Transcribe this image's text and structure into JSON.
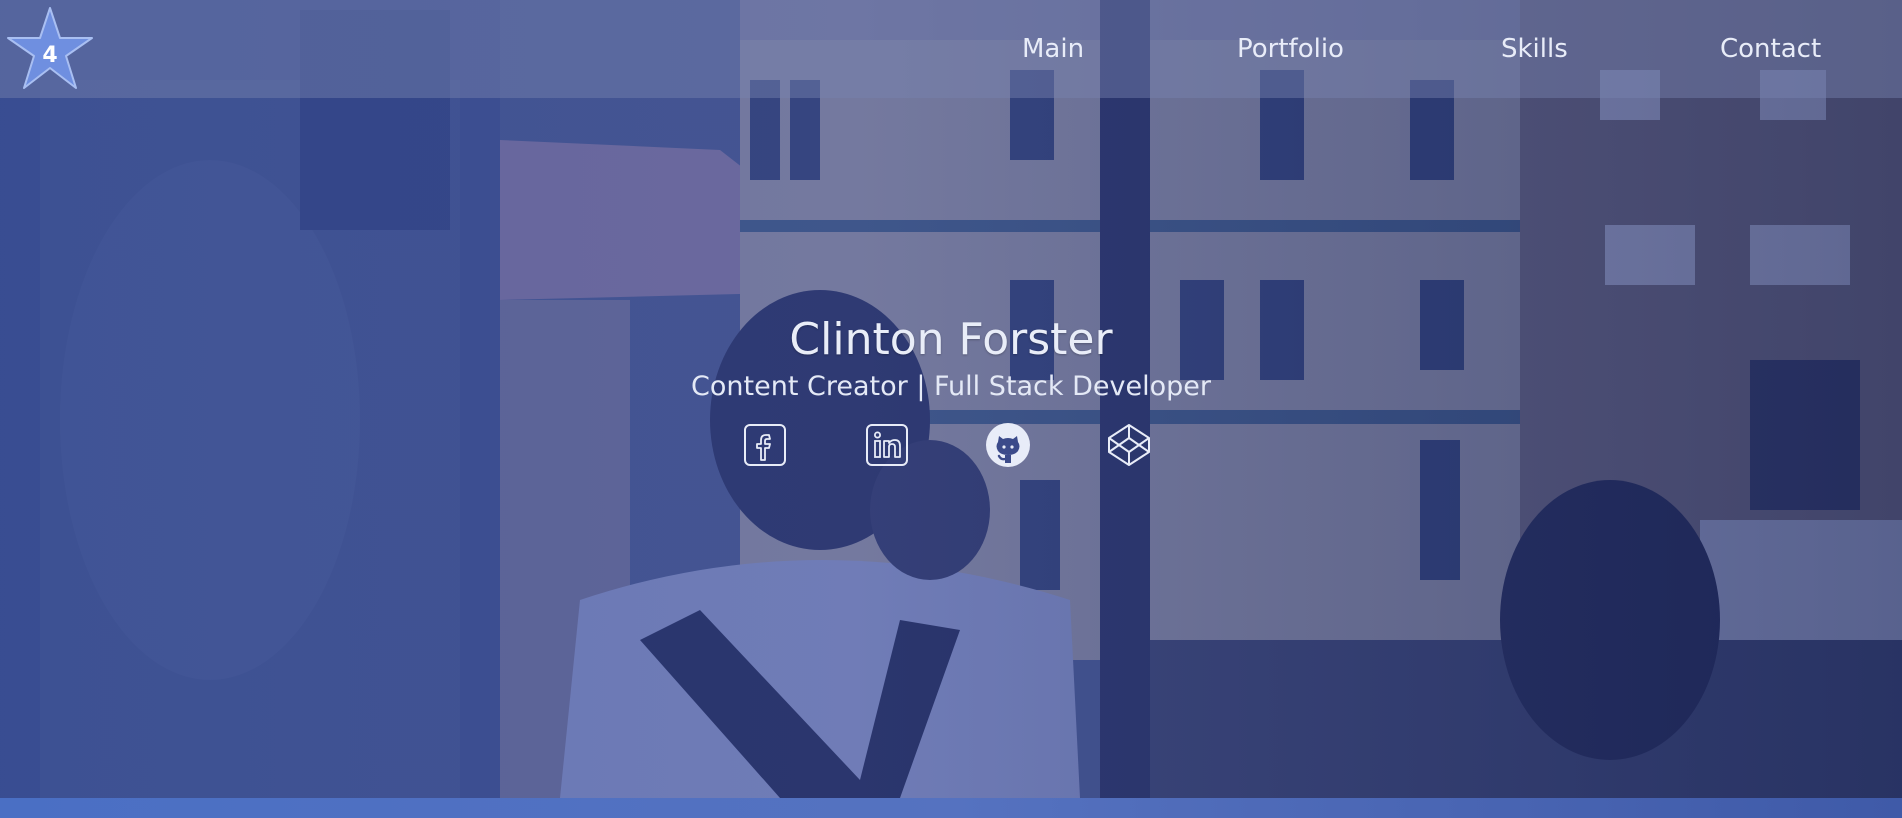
{
  "nav": {
    "logo_text": "4",
    "links": [
      {
        "label": "Main"
      },
      {
        "label": "Portfolio"
      },
      {
        "label": "Skills"
      },
      {
        "label": "Contact"
      }
    ]
  },
  "hero": {
    "title": "Clinton Forster",
    "subtitle": "Content Creator | Full Stack Developer",
    "social_icons": [
      "facebook-icon",
      "linkedin-icon",
      "github-icon",
      "codepen-icon"
    ]
  },
  "colors": {
    "tint": "#2b3f94",
    "text": "#e8ecf8",
    "bottom_bar": "#4a6fc4"
  }
}
